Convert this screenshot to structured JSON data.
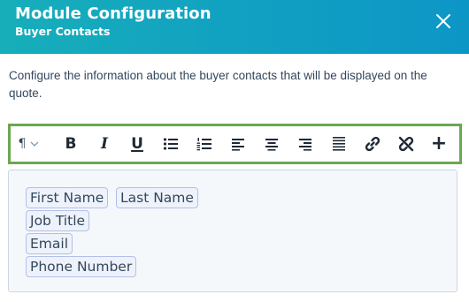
{
  "header": {
    "title": "Module Configuration",
    "subtitle": "Buyer Contacts",
    "close_icon": "close-icon",
    "colors": {
      "gradient_start": "#17aeba",
      "gradient_end": "#0c96c6"
    }
  },
  "description": "Configure the information about the buyer contacts that will be displayed on the quote.",
  "toolbar": {
    "highlight_color": "#6aa84f",
    "paragraph_symbol": "¶",
    "buttons": [
      {
        "name": "paragraph-style",
        "icon": "paragraph-icon"
      },
      {
        "name": "bold",
        "label": "B",
        "icon": "bold-icon"
      },
      {
        "name": "italic",
        "label": "I",
        "icon": "italic-icon"
      },
      {
        "name": "underline",
        "label": "U",
        "icon": "underline-icon"
      },
      {
        "name": "bulleted-list",
        "icon": "bulleted-list-icon"
      },
      {
        "name": "numbered-list",
        "icon": "numbered-list-icon"
      },
      {
        "name": "align-left",
        "icon": "align-left-icon"
      },
      {
        "name": "align-center",
        "icon": "align-center-icon"
      },
      {
        "name": "align-right",
        "icon": "align-right-icon"
      },
      {
        "name": "justify",
        "icon": "justify-icon"
      },
      {
        "name": "insert-link",
        "icon": "link-icon"
      },
      {
        "name": "remove-link",
        "icon": "unlink-icon"
      },
      {
        "name": "insert",
        "label": "+",
        "icon": "plus-icon"
      }
    ]
  },
  "editor": {
    "tokens": [
      "First Name",
      "Last Name",
      "Job Title",
      "Email",
      "Phone Number"
    ]
  }
}
